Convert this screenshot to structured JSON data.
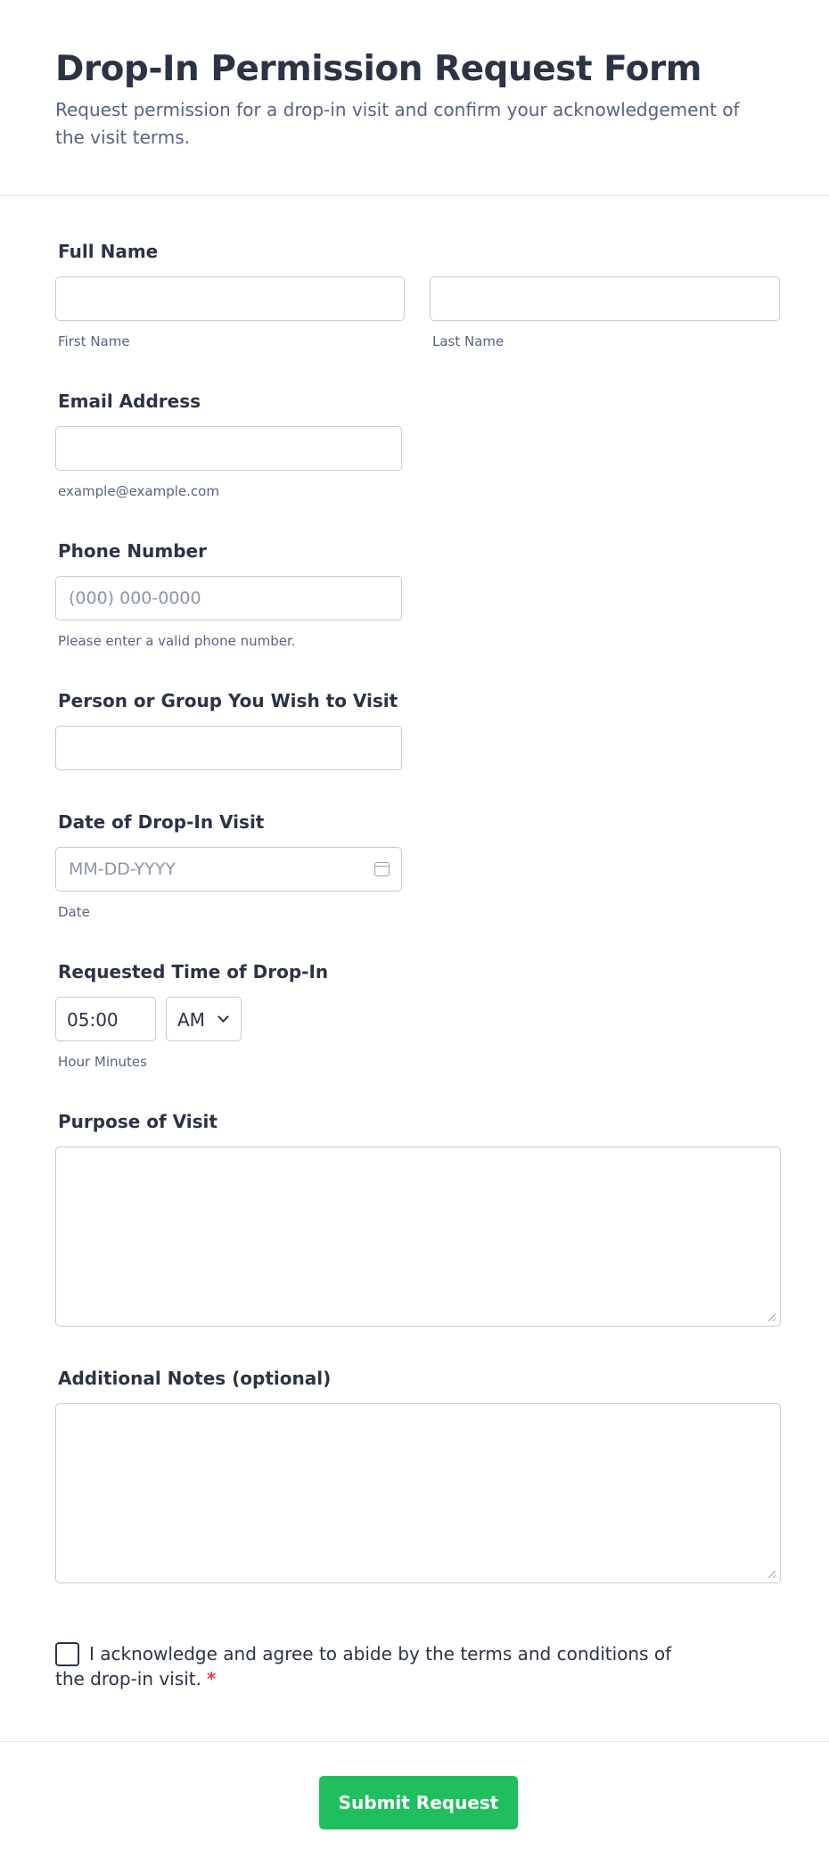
{
  "header": {
    "title": "Drop-In Permission Request Form",
    "subtitle": "Request permission for a drop-in visit and confirm your acknowledgement of the visit terms."
  },
  "fields": {
    "full_name": {
      "label": "Full Name",
      "first_sublabel": "First Name",
      "last_sublabel": "Last Name"
    },
    "email": {
      "label": "Email Address",
      "sublabel": "example@example.com"
    },
    "phone": {
      "label": "Phone Number",
      "placeholder": "(000) 000-0000",
      "sublabel": "Please enter a valid phone number."
    },
    "visit_person": {
      "label": "Person or Group You Wish to Visit"
    },
    "visit_date": {
      "label": "Date of Drop-In Visit",
      "placeholder": "MM-DD-YYYY",
      "sublabel": "Date",
      "icon": "calendar-icon"
    },
    "visit_time": {
      "label": "Requested Time of Drop-In",
      "value": "05:00",
      "period": "AM",
      "sublabel": "Hour Minutes"
    },
    "purpose": {
      "label": "Purpose of Visit"
    },
    "notes": {
      "label": "Additional Notes (optional)"
    }
  },
  "acknowledgement": {
    "text": "I acknowledge and agree to abide by the terms and conditions of the drop-in visit.",
    "required_mark": "*"
  },
  "submit": {
    "label": "Submit Request",
    "color": "#1fbe5e"
  }
}
